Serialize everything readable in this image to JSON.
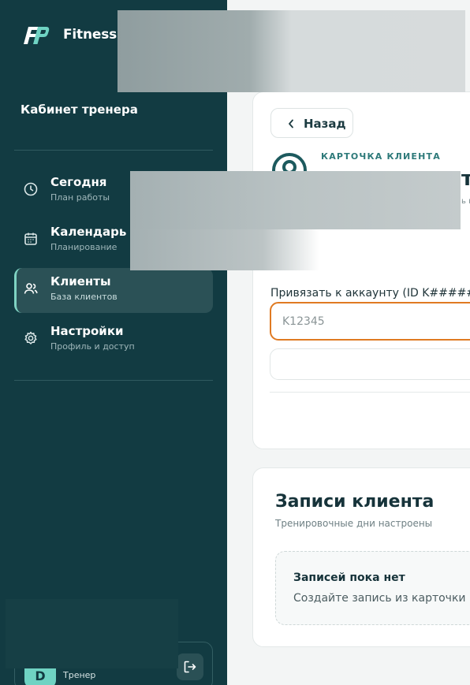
{
  "brand": {
    "name": "Fitness P"
  },
  "sidebar": {
    "section_title": "Кабинет тренера",
    "items": [
      {
        "title": "Сегодня",
        "subtitle": "План работы",
        "icon": "clock-icon",
        "active": false
      },
      {
        "title": "Календарь",
        "subtitle": "Планирование",
        "icon": "calendar-icon",
        "active": false
      },
      {
        "title": "Клиенты",
        "subtitle": "База клиентов",
        "icon": "users-icon",
        "active": true
      },
      {
        "title": "Настройки",
        "subtitle": "Профиль и доступ",
        "icon": "gear-icon",
        "active": false
      }
    ],
    "user": {
      "avatar_initial": "D",
      "role": "Тренер"
    }
  },
  "client_card": {
    "back_label": "Назад",
    "eyebrow": "КАРТОЧКА КЛИЕНТА",
    "name_tail": "т",
    "subtitle_tail": "ь н",
    "link_label": "Привязать к аккаунту (ID K#####)",
    "link_placeholder": "K12345",
    "link_value": ""
  },
  "records": {
    "title": "Записи клиента",
    "subtitle": "Тренировочные дни настроены",
    "empty_title": "Записей пока нет",
    "empty_text": "Создайте запись из карточки к"
  },
  "colors": {
    "sidebar_bg": "#123b42",
    "accent": "#6fd3c3",
    "input_focus": "#e07a22",
    "page_bg": "#f3f5f5"
  }
}
